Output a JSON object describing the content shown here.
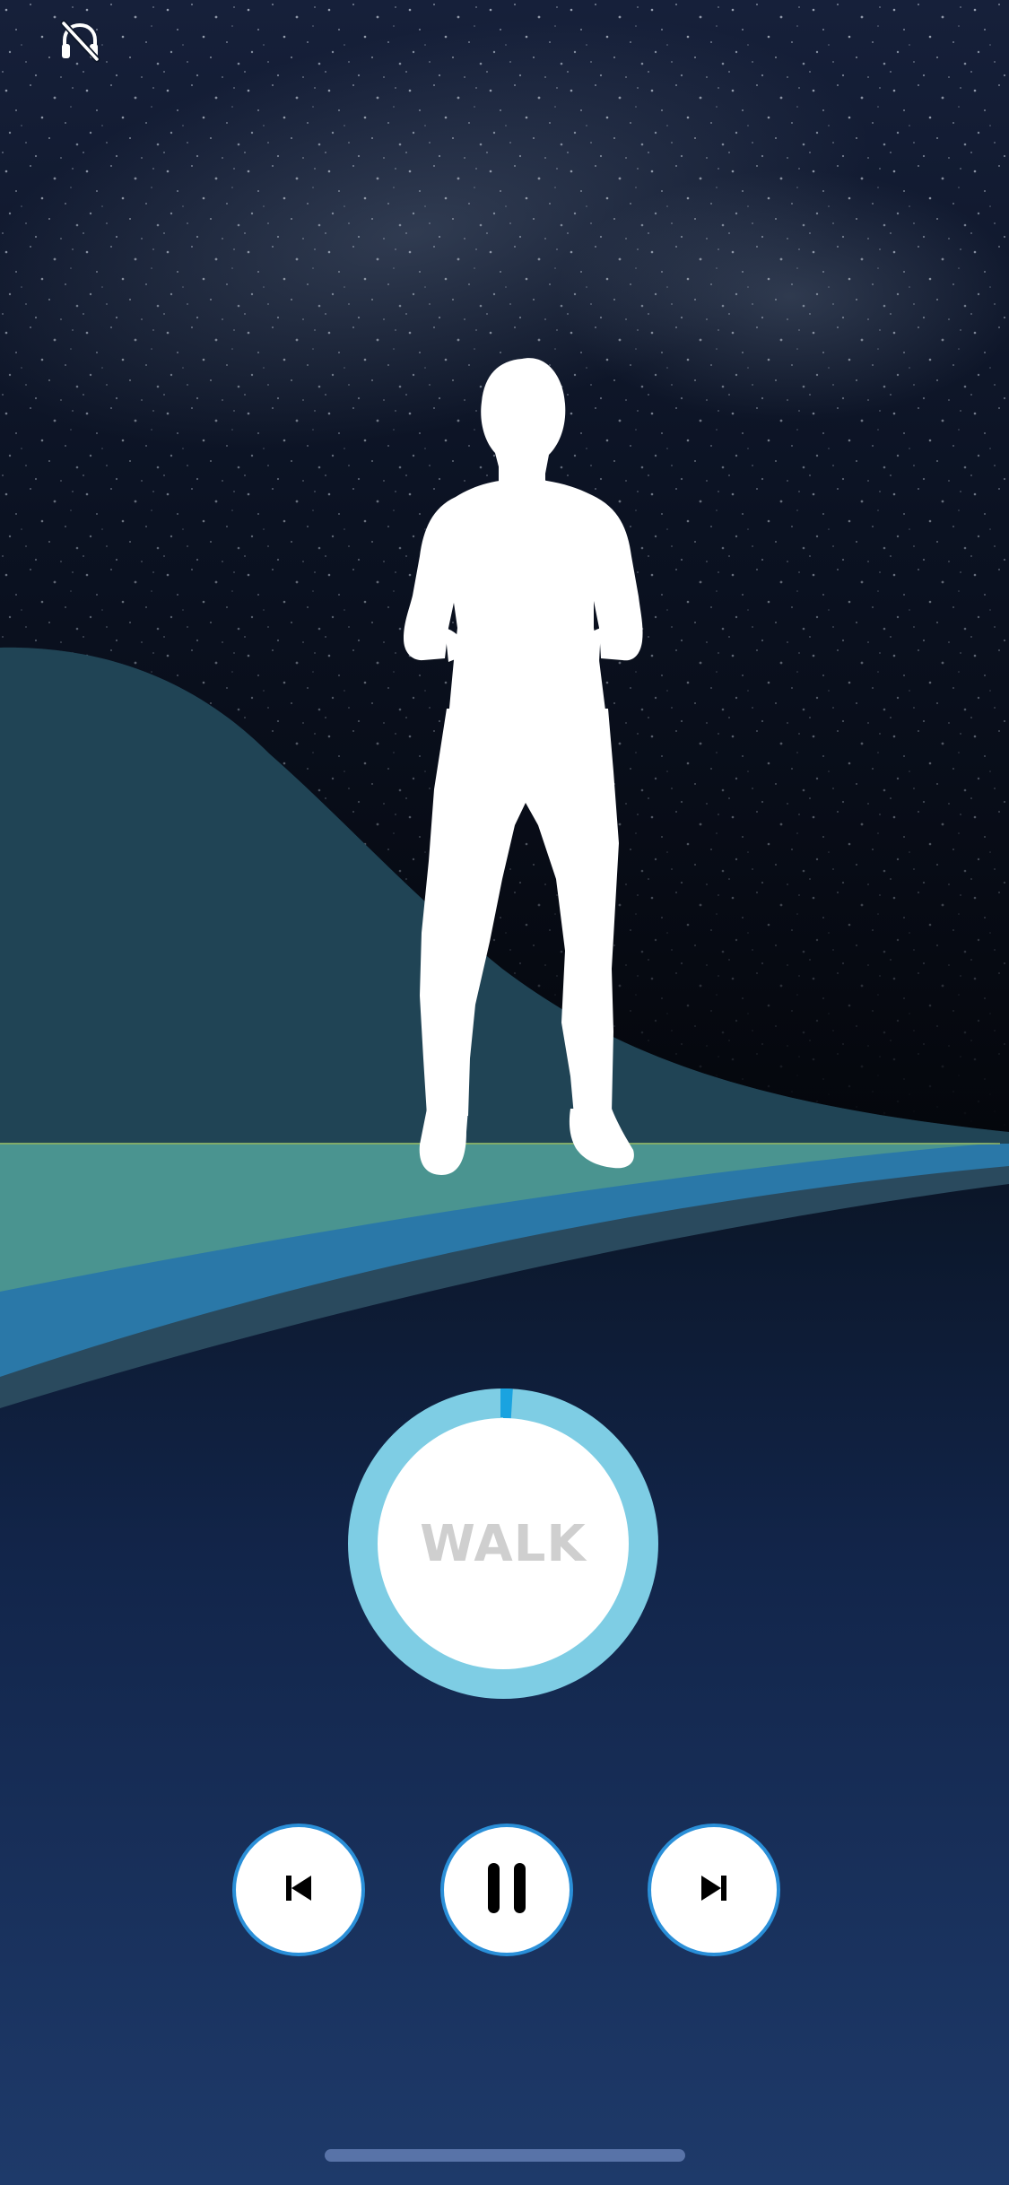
{
  "app": {
    "screen": "walk-session"
  },
  "header": {
    "audio_icon": "headphones-off-icon"
  },
  "session": {
    "activity_label": "WALK",
    "progress": 0.01
  },
  "controls": {
    "previous_icon": "skip-previous-icon",
    "pause_icon": "pause-icon",
    "next_icon": "skip-next-icon"
  },
  "colors": {
    "ring": "#7ecde4",
    "ring_marker": "#1aa3e0",
    "button_border": "#2a8fd8",
    "wave_teal": "#4a9490",
    "wave_blue": "#2a7aa8",
    "hill": "#244a5a",
    "bottom_gradient_end": "#1e3a6a"
  }
}
